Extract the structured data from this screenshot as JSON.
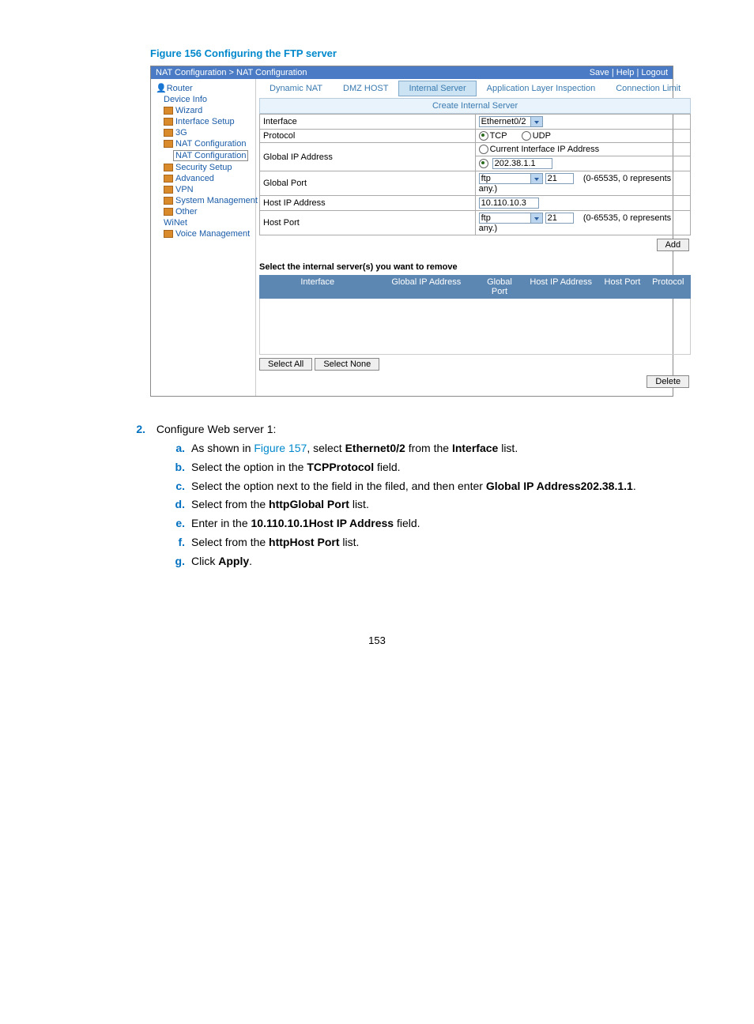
{
  "figure_caption": "Figure 156 Configuring the FTP server",
  "breadcrumb": {
    "path": "NAT Configuration > NAT Configuration",
    "links": "Save | Help | Logout"
  },
  "tree": {
    "root": "Router",
    "items": [
      {
        "label": "Device Info",
        "lvl": 1
      },
      {
        "label": "Wizard",
        "lvl": 1,
        "icon": true
      },
      {
        "label": "Interface Setup",
        "lvl": 1,
        "icon": true
      },
      {
        "label": "3G",
        "lvl": 1,
        "icon": true
      },
      {
        "label": "NAT Configuration",
        "lvl": 1,
        "icon": true
      },
      {
        "label": "NAT Configuration",
        "lvl": 2,
        "selected": true
      },
      {
        "label": "Security Setup",
        "lvl": 1,
        "icon": true
      },
      {
        "label": "Advanced",
        "lvl": 1,
        "icon": true
      },
      {
        "label": "VPN",
        "lvl": 1,
        "icon": true
      },
      {
        "label": "System Management",
        "lvl": 1,
        "icon": true
      },
      {
        "label": "Other",
        "lvl": 1,
        "icon": true
      },
      {
        "label": "WiNet",
        "lvl": 1
      },
      {
        "label": "Voice Management",
        "lvl": 1,
        "icon": true
      }
    ]
  },
  "tabs": [
    "Dynamic NAT",
    "DMZ HOST",
    "Internal Server",
    "Application Layer Inspection",
    "Connection Limit"
  ],
  "active_tab": "Internal Server",
  "subheader": "Create Internal Server",
  "form": {
    "interface": {
      "label": "Interface",
      "value": "Ethernet0/2"
    },
    "protocol": {
      "label": "Protocol",
      "tcp": "TCP",
      "udp": "UDP"
    },
    "globalip": {
      "label": "Global IP Address",
      "opt1": "Current Interface IP Address",
      "value": "202.38.1.1"
    },
    "globalport": {
      "label": "Global Port",
      "sel": "ftp",
      "num": "21",
      "hint": "(0-65535, 0 represents any.)"
    },
    "hostip": {
      "label": "Host IP Address",
      "value": "10.110.10.3"
    },
    "hostport": {
      "label": "Host Port",
      "sel": "ftp",
      "num": "21",
      "hint": "(0-65535, 0 represents any.)"
    }
  },
  "buttons": {
    "add": "Add",
    "selall": "Select All",
    "selnone": "Select None",
    "delete": "Delete"
  },
  "remove_header": "Select the internal server(s) you want to remove",
  "list_cols": [
    "Interface",
    "Global IP Address",
    "Global Port",
    "Host IP Address",
    "Host Port",
    "Protocol"
  ],
  "step": {
    "num": "2.",
    "text": "Configure Web server 1:",
    "subs": [
      {
        "l": "a.",
        "pre": "As shown in ",
        "link": "Figure 157",
        "mid": ", select ",
        "b1": "Ethernet0/2",
        "mid2": " from the ",
        "b2": "Interface",
        "tail": " list."
      },
      {
        "l": "b.",
        "pre": "Select the ",
        "b1": "TCP",
        "mid": " option in the ",
        "b2": "Protocol",
        "tail": " field."
      },
      {
        "l": "c.",
        "pre": "Select the option next to the field in the ",
        "b1": "Global IP Address",
        "mid": " filed, and then enter ",
        "b2": "202.38.1.1",
        "tail": "."
      },
      {
        "l": "d.",
        "pre": "Select ",
        "b1": "http",
        "mid": " from the ",
        "b2": "Global Port",
        "tail": " list."
      },
      {
        "l": "e.",
        "pre": "Enter ",
        "b1": "10.110.10.1",
        "mid": " in the ",
        "b2": "Host IP Address",
        "tail": " field."
      },
      {
        "l": "f.",
        "pre": "Select ",
        "b1": "http",
        "mid": " from the ",
        "b2": "Host Port",
        "tail": " list."
      },
      {
        "l": "g.",
        "pre": "Click ",
        "b1": "Apply",
        "tail": "."
      }
    ]
  },
  "page_number": "153"
}
